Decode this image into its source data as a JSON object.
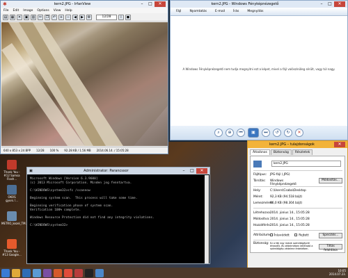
{
  "irfan": {
    "title": "kern2.JPG - IrfanView",
    "menu": [
      "File",
      "Edit",
      "Image",
      "Options",
      "View",
      "Help"
    ],
    "page": "12/28",
    "status": [
      "640 x 853 x 24 BPP",
      "12/28",
      "100 %",
      "92.28 KB / 1.56 MB",
      "2014.06.14. / 15:05:28"
    ]
  },
  "viewer": {
    "title": "kern2.JPG - Windows Fényképnézegető",
    "cmd": [
      "Fájl",
      "Nyomtatás",
      "E-mail",
      "Írás",
      "Megnyitás"
    ],
    "message": "A Windows Fényképnézegető nem tudja megnyitni ezt a képet, mivel a fájl valószínűleg sérült, vagy túl nagy."
  },
  "cmd": {
    "title": "Administrator: Parancssor",
    "lines": [
      "Microsoft Windows [Version 6.3.9600]",
      "(c) 2013 Microsoft Corporation. Minden jog fenntartva.",
      "",
      "C:\\WINDOWS\\system32>sfc /scannow",
      "",
      "Beginning system scan.  This process will take some time.",
      "",
      "Beginning verification phase of system scan.",
      "Verification 100% complete.",
      "",
      "Windows Resource Protection did not find any integrity violations.",
      "",
      "C:\\WINDOWS\\system32>"
    ]
  },
  "props": {
    "title": "kern2.JPG – tulajdonságok",
    "tabs": [
      "Általános",
      "Biztonság",
      "Részletek"
    ],
    "filename": "kern2.JPG",
    "rows": [
      {
        "k": "Fájltípus:",
        "v": "JPG-fájl (.JPG)"
      },
      {
        "k": "Társítás:",
        "v": "Windows Fényképnézegető"
      },
      {
        "k": "Hely:",
        "v": "C:\\Users\\Csaba\\Desktop"
      },
      {
        "k": "Méret:",
        "v": "92,3 KB (94.518 bájt)"
      },
      {
        "k": "Lemezméret:",
        "v": "96,0 KB (98.304 bájt)"
      },
      {
        "k": "Létrehozva:",
        "v": "2014. június 14., 15:05:28"
      },
      {
        "k": "Módosítva:",
        "v": "2014. június 14., 15:05:28"
      },
      {
        "k": "Hozzáférés:",
        "v": "2014. június 14., 15:05:28"
      }
    ],
    "change_label": "Módosítás...",
    "attr_label": "Attribútumok:",
    "readonly_label": "Írásvédett",
    "hidden_label": "Rejtett",
    "special_label": "Speciális...",
    "security_label": "Biztonság:",
    "security_text": "Ez a fájl egy másik számítógépről érkezett, és védelmében letiltható a számítógép védelme érdekében.",
    "unlock_label": "Tiltás feloldása"
  },
  "desktop": {
    "icons": [
      "Thank You - #12 Samsa Flash...",
      "OKOS gyors.!...",
      "METRO_kezel_TM...",
      "Thank You - #13 Google..."
    ]
  },
  "taskbar": {
    "time": "10:05",
    "date": "2014.07.23."
  }
}
